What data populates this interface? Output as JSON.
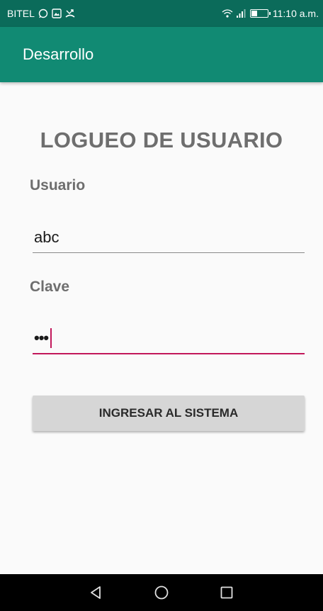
{
  "status_bar": {
    "carrier": "BITEL",
    "time": "11:10 a.m.",
    "icons": [
      "whatsapp-icon",
      "gallery-icon",
      "missed-call-icon",
      "wifi-icon",
      "signal-icon",
      "battery-icon"
    ]
  },
  "app_bar": {
    "title": "Desarrollo"
  },
  "form": {
    "heading": "LOGUEO DE USUARIO",
    "usuario_label": "Usuario",
    "usuario_value": "abc",
    "clave_label": "Clave",
    "clave_value": "•••",
    "submit_label": "INGRESAR AL SISTEMA"
  },
  "nav_bar": {
    "icons": [
      "back-icon",
      "home-icon",
      "recents-icon"
    ]
  },
  "colors": {
    "status_bar": "#0b6b5a",
    "app_bar": "#118a73",
    "accent": "#c2185b",
    "background": "#fafafa"
  }
}
